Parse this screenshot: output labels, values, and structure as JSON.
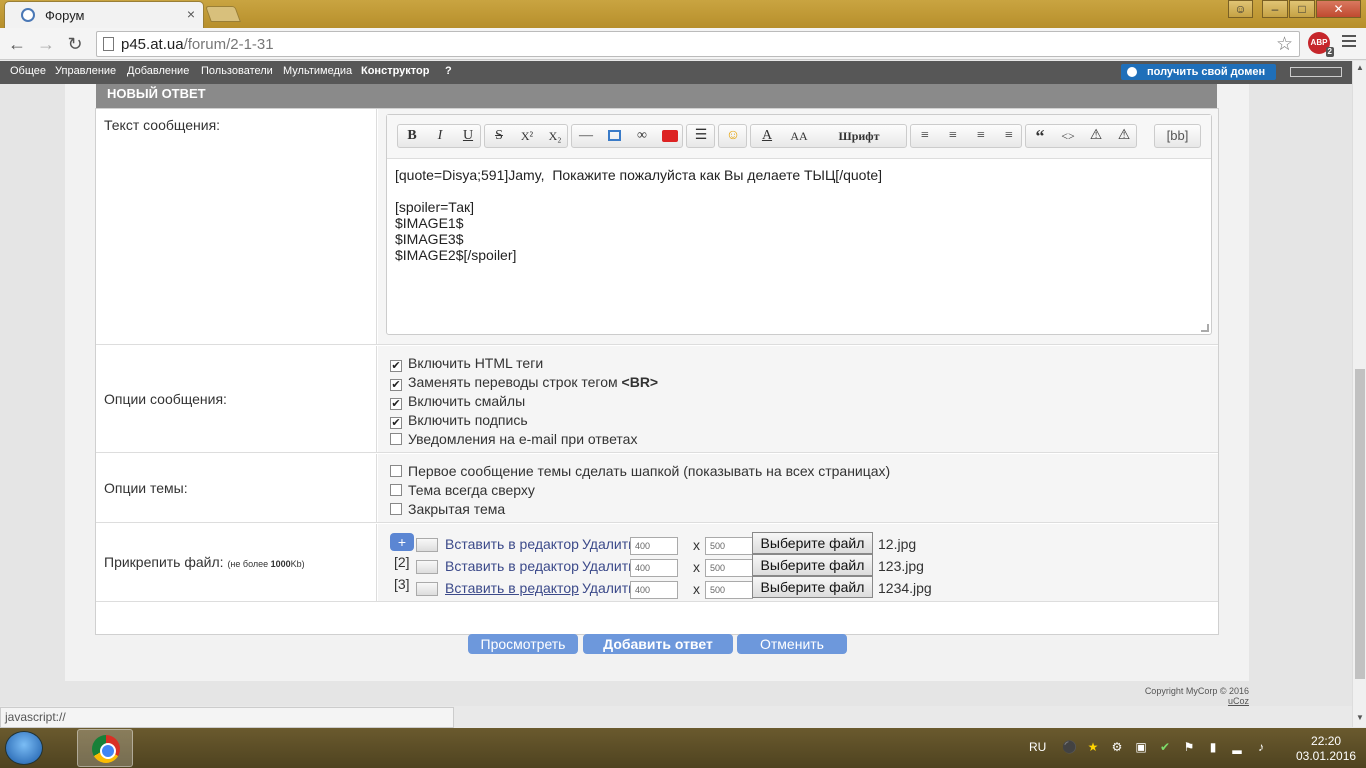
{
  "browser": {
    "tab_title": "Форум",
    "tab_close": "×",
    "url_host": "p45.at.ua",
    "url_path": "/forum/2-1-31",
    "abp_label": "ABP",
    "abp_count": "2",
    "nav_back": "←",
    "nav_forward": "→",
    "nav_reload": "↻",
    "star": "☆",
    "win_min": "–",
    "win_max": "□",
    "win_close": "✕"
  },
  "ucoz_panel": {
    "items": [
      "Общее",
      "Управление",
      "Добавление",
      "Пользователи",
      "Мультимедиа",
      "Конструктор",
      "?"
    ],
    "domain_button": "получить свой домен"
  },
  "form": {
    "header": "НОВЫЙ ОТВЕТ",
    "message_label": "Текст сообщения:",
    "message_text": "[quote=Disya;591]Jamy,  Покажите пожалуйста как Вы делаете ТЫЦ[/quote]\n\n[spoiler=Так]\n$IMAGE1$\n$IMAGE3$\n$IMAGE2$[/spoiler]",
    "editor_buttons": {
      "bold": "B",
      "italic": "I",
      "underline": "U",
      "strike": "S",
      "sup": "X²",
      "sub": "X₂",
      "font_size": "AA",
      "font_family": "Шрифт",
      "quote": "“",
      "code": "<>",
      "bb": "[bb]"
    },
    "message_options_label": "Опции сообщения:",
    "message_options": [
      {
        "label": "Включить HTML теги",
        "checked": true
      },
      {
        "label": "Заменять переводы строк тегом",
        "bold": "<BR>",
        "checked": true
      },
      {
        "label": "Включить смайлы",
        "checked": true
      },
      {
        "label": "Включить подпись",
        "checked": true
      },
      {
        "label": "Уведомления на e-mail при ответах",
        "checked": false
      }
    ],
    "topic_options_label": "Опции темы:",
    "topic_options": [
      {
        "label": "Первое сообщение темы сделать шапкой (показывать на всех страницах)",
        "checked": false
      },
      {
        "label": "Тема всегда сверху",
        "checked": false
      },
      {
        "label": "Закрытая тема",
        "checked": false
      }
    ],
    "attach_label": "Прикрепить файл:",
    "attach_limit_prefix": "(не более ",
    "attach_limit_value": "1000",
    "attach_limit_suffix": "Kb)",
    "attach_plus": "+",
    "attachments": [
      {
        "index": "",
        "insert": "Вставить в редактор",
        "delete": "Удалить",
        "w": "400",
        "h": "500",
        "choose": "Выберите файл",
        "file": "12.jpg"
      },
      {
        "index": "[2]",
        "insert": "Вставить в редактор",
        "delete": "Удалить",
        "w": "400",
        "h": "500",
        "choose": "Выберите файл",
        "file": "123.jpg"
      },
      {
        "index": "[3]",
        "insert": "Вставить в редактор",
        "delete": "Удалить",
        "w": "400",
        "h": "500",
        "choose": "Выберите файл",
        "file": "1234.jpg"
      }
    ],
    "x_sep": "x",
    "buttons": {
      "preview": "Просмотреть",
      "submit": "Добавить ответ",
      "cancel": "Отменить"
    }
  },
  "footer": {
    "copyright": "Copyright MyCorp © 2016",
    "ucoz": "uCoz"
  },
  "status_text": "javascript://",
  "taskbar": {
    "lang": "RU",
    "time": "22:20",
    "date": "03.01.2016"
  }
}
